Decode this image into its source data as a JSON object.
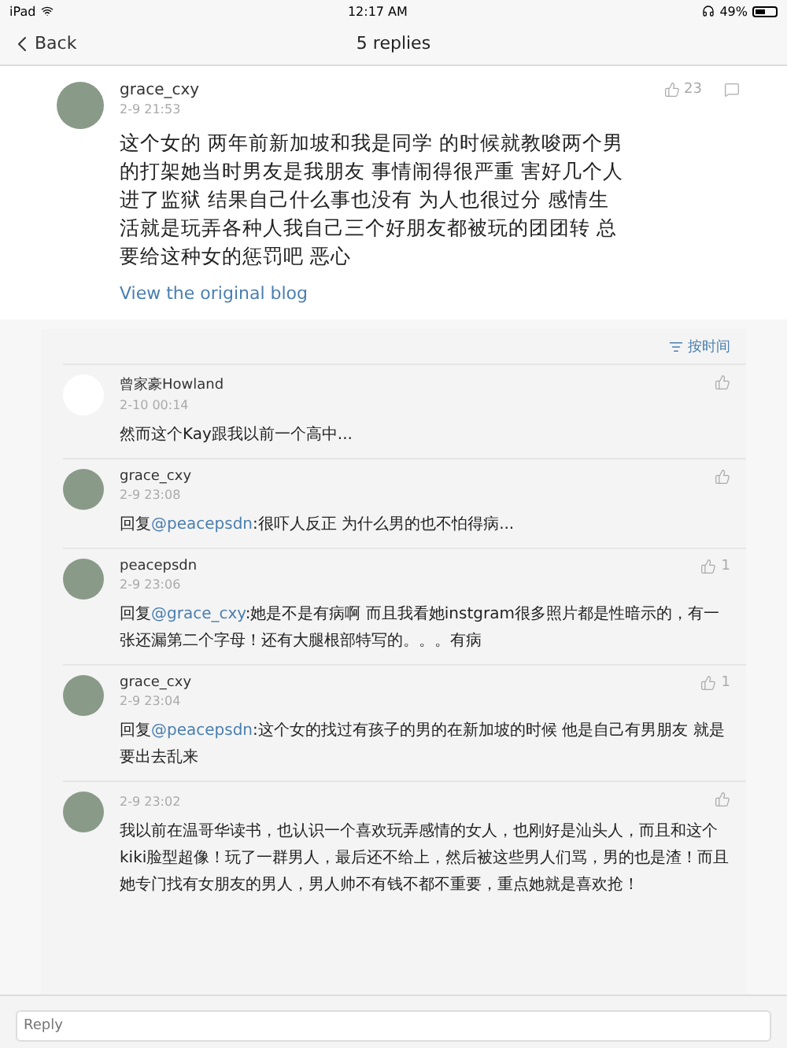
{
  "status_bar": {
    "device": "iPad",
    "time": "12:17 AM",
    "battery": "49%"
  },
  "nav": {
    "back": "Back",
    "title": "5 replies"
  },
  "post": {
    "author": "grace_cxy",
    "time": "2-9 21:53",
    "likes": "23",
    "text": "这个女的 两年前新加坡和我是同学 的时候就教唆两个男的打架她当时男友是我朋友  事情闹得很严重 害好几个人进了监狱 结果自己什么事也没有  为人也很过分 感情生活就是玩弄各种人我自己三个好朋友都被玩的团团转 总要给这种女的惩罚吧  恶心",
    "link": "View the original blog"
  },
  "sort": {
    "label": "按时间"
  },
  "comments": [
    {
      "kind": "blank",
      "author": "曾家豪Howland",
      "time": "2-10 00:14",
      "text": "然而这个Kay跟我以前一个高中..."
    },
    {
      "kind": "photo",
      "author": "grace_cxy",
      "time": "2-9 23:08",
      "prefix": "回复",
      "mention": "@peacepsdn",
      "text": ":很吓人反正 为什么男的也不怕得病..."
    },
    {
      "kind": "photo",
      "author": "peacepsdn",
      "time": "2-9 23:06",
      "prefix": "回复",
      "mention": "@grace_cxy",
      "text": ":她是不是有病啊 而且我看她instgram很多照片都是性暗示的，有一张还漏第二个字母！还有大腿根部特写的。。。有病",
      "likes": "1"
    },
    {
      "kind": "photo",
      "author": "grace_cxy",
      "time": "2-9 23:04",
      "prefix": "回复",
      "mention": "@peacepsdn",
      "text": ":这个女的找过有孩子的男的在新加坡的时候 他是自己有男朋友 就是要出去乱来",
      "likes": "1"
    },
    {
      "kind": "photo",
      "time": "2-9 23:02",
      "text": "我以前在温哥华读书，也认识一个喜欢玩弄感情的女人，也刚好是汕头人，而且和这个kiki脸型超像！玩了一群男人，最后还不给上，然后被这些男人们骂，男的也是渣！而且她专门找有女朋友的男人，男人帅不有钱不都不重要，重点她就是喜欢抢！"
    }
  ],
  "reply": {
    "placeholder": "Reply"
  }
}
